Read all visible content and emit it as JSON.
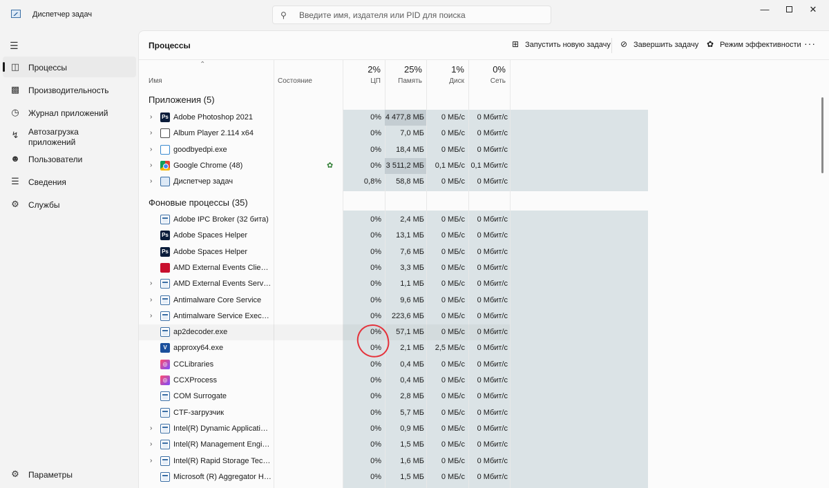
{
  "window": {
    "title": "Диспетчер задач",
    "search_placeholder": "Введите имя, издателя или PID для поиска",
    "controls": {
      "minimize": "—",
      "close": "✕"
    }
  },
  "sidebar": {
    "items": [
      {
        "label": "Процессы",
        "icon": "processes-icon",
        "active": true
      },
      {
        "label": "Производительность",
        "icon": "performance-icon"
      },
      {
        "label": "Журнал приложений",
        "icon": "app-history-icon"
      },
      {
        "label": "Автозагрузка\nприложений",
        "icon": "startup-icon"
      },
      {
        "label": "Пользователи",
        "icon": "users-icon"
      },
      {
        "label": "Сведения",
        "icon": "details-icon"
      },
      {
        "label": "Службы",
        "icon": "services-icon"
      }
    ],
    "settings_label": "Параметры"
  },
  "toolbar": {
    "title": "Процессы",
    "run_task": "Запустить новую задачу",
    "end_task": "Завершить задачу",
    "efficiency": "Режим эффективности",
    "more": "···"
  },
  "columns": {
    "name": "Имя",
    "status": "Состояние",
    "cpu": {
      "pct": "2%",
      "label": "ЦП"
    },
    "memory": {
      "pct": "25%",
      "label": "Память"
    },
    "disk": {
      "pct": "1%",
      "label": "Диск"
    },
    "network": {
      "pct": "0%",
      "label": "Сеть"
    }
  },
  "groups": {
    "apps": "Приложения (5)",
    "background": "Фоновые процессы (35)"
  },
  "apps": [
    {
      "name": "Adobe Photoshop 2021",
      "icon": "ps",
      "expand": true,
      "cpu": "0%",
      "mem": "4 477,8 МБ",
      "disk": "0 МБ/с",
      "net": "0 Мбит/с",
      "mem_hot": true
    },
    {
      "name": "Album Player 2.114 x64",
      "icon": "album",
      "expand": true,
      "cpu": "0%",
      "mem": "7,0 МБ",
      "disk": "0 МБ/с",
      "net": "0 Мбит/с"
    },
    {
      "name": "goodbyedpi.exe",
      "icon": "gbd",
      "expand": true,
      "cpu": "0%",
      "mem": "18,4 МБ",
      "disk": "0 МБ/с",
      "net": "0 Мбит/с"
    },
    {
      "name": "Google Chrome (48)",
      "icon": "chrome",
      "expand": true,
      "cpu": "0%",
      "mem": "3 511,2 МБ",
      "disk": "0,1 МБ/с",
      "net": "0,1 Мбит/с",
      "mem_hot": true,
      "efficiency": true
    },
    {
      "name": "Диспетчер задач",
      "icon": "tm",
      "expand": true,
      "cpu": "0,8%",
      "mem": "58,8 МБ",
      "disk": "0 МБ/с",
      "net": "0 Мбит/с"
    }
  ],
  "background": [
    {
      "name": "Adobe IPC Broker (32 бита)",
      "icon": "svc",
      "expand": false,
      "cpu": "0%",
      "mem": "2,4 МБ",
      "disk": "0 МБ/с",
      "net": "0 Мбит/с"
    },
    {
      "name": "Adobe Spaces Helper",
      "icon": "ps",
      "expand": false,
      "cpu": "0%",
      "mem": "13,1 МБ",
      "disk": "0 МБ/с",
      "net": "0 Мбит/с"
    },
    {
      "name": "Adobe Spaces Helper",
      "icon": "ps",
      "expand": false,
      "cpu": "0%",
      "mem": "7,6 МБ",
      "disk": "0 МБ/с",
      "net": "0 Мбит/с"
    },
    {
      "name": "AMD External Events Client M...",
      "icon": "amd",
      "expand": false,
      "cpu": "0%",
      "mem": "3,3 МБ",
      "disk": "0 МБ/с",
      "net": "0 Мбит/с"
    },
    {
      "name": "AMD External Events Service ...",
      "icon": "svc",
      "expand": true,
      "cpu": "0%",
      "mem": "1,1 МБ",
      "disk": "0 МБ/с",
      "net": "0 Мбит/с"
    },
    {
      "name": "Antimalware Core Service",
      "icon": "svc",
      "expand": true,
      "cpu": "0%",
      "mem": "9,6 МБ",
      "disk": "0 МБ/с",
      "net": "0 Мбит/с"
    },
    {
      "name": "Antimalware Service Executable",
      "icon": "svc",
      "expand": true,
      "cpu": "0%",
      "mem": "223,6 МБ",
      "disk": "0 МБ/с",
      "net": "0 Мбит/с"
    },
    {
      "name": "ap2decoder.exe",
      "icon": "svc",
      "expand": false,
      "cpu": "0%",
      "mem": "57,1 МБ",
      "disk": "0 МБ/с",
      "net": "0 Мбит/с",
      "hover": true
    },
    {
      "name": "approxy64.exe",
      "icon": "approxy",
      "expand": false,
      "cpu": "0%",
      "mem": "2,1 МБ",
      "disk": "2,5 МБ/с",
      "net": "0 Мбит/с"
    },
    {
      "name": "CCLibraries",
      "icon": "cc",
      "expand": false,
      "cpu": "0%",
      "mem": "0,4 МБ",
      "disk": "0 МБ/с",
      "net": "0 Мбит/с"
    },
    {
      "name": "CCXProcess",
      "icon": "cc",
      "expand": false,
      "cpu": "0%",
      "mem": "0,4 МБ",
      "disk": "0 МБ/с",
      "net": "0 Мбит/с"
    },
    {
      "name": "COM Surrogate",
      "icon": "svc",
      "expand": false,
      "cpu": "0%",
      "mem": "2,8 МБ",
      "disk": "0 МБ/с",
      "net": "0 Мбит/с"
    },
    {
      "name": "CTF-загрузчик",
      "icon": "svc",
      "expand": false,
      "cpu": "0%",
      "mem": "5,7 МБ",
      "disk": "0 МБ/с",
      "net": "0 Мбит/с"
    },
    {
      "name": "Intel(R) Dynamic Application ...",
      "icon": "svc",
      "expand": true,
      "cpu": "0%",
      "mem": "0,9 МБ",
      "disk": "0 МБ/с",
      "net": "0 Мбит/с"
    },
    {
      "name": "Intel(R) Management Engine ...",
      "icon": "svc",
      "expand": true,
      "cpu": "0%",
      "mem": "1,5 МБ",
      "disk": "0 МБ/с",
      "net": "0 Мбит/с"
    },
    {
      "name": "Intel(R) Rapid Storage Technol...",
      "icon": "svc",
      "expand": true,
      "cpu": "0%",
      "mem": "1,6 МБ",
      "disk": "0 МБ/с",
      "net": "0 Мбит/с"
    },
    {
      "name": "Microsoft (R) Aggregator Host",
      "icon": "svc",
      "expand": false,
      "cpu": "0%",
      "mem": "1,5 МБ",
      "disk": "0 МБ/с",
      "net": "0 Мбит/с"
    }
  ],
  "colors": {
    "heat_low": "#dbe3e6",
    "heat_hot": "#c4cdd2",
    "annotation": "#e5323b"
  }
}
